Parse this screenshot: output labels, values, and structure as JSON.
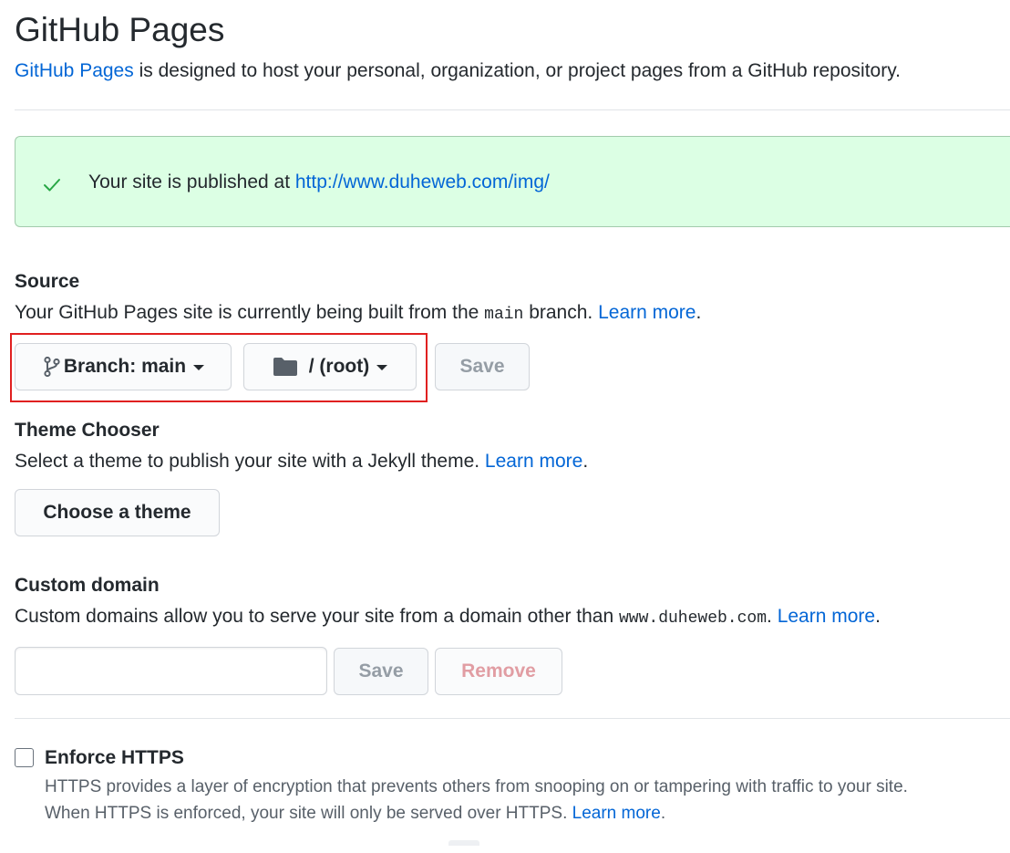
{
  "header": {
    "title": "GitHub Pages",
    "intro_link": "GitHub Pages",
    "intro_rest": " is designed to host your personal, organization, or project pages from a GitHub repository."
  },
  "flash": {
    "message": "Your site is published at ",
    "url": "http://www.duheweb.com/img/",
    "icon": "check-icon",
    "color": "#28a745"
  },
  "source": {
    "title": "Source",
    "desc_before": "Your GitHub Pages site is currently being built from the ",
    "branch_code": "main",
    "desc_after": " branch. ",
    "learn_more": "Learn more",
    "period": ".",
    "branch_button": "Branch: main",
    "folder_button": "/ (root)",
    "save_button": "Save",
    "highlight_color": "#e02020"
  },
  "theme": {
    "title": "Theme Chooser",
    "desc": "Select a theme to publish your site with a Jekyll theme. ",
    "learn_more": "Learn more",
    "period": ".",
    "button": "Choose a theme"
  },
  "custom_domain": {
    "title": "Custom domain",
    "desc_before": "Custom domains allow you to serve your site from a domain other than ",
    "domain_code": "www.duheweb.com",
    "desc_after": ". ",
    "learn_more": "Learn more",
    "period": ".",
    "input_value": "",
    "save_button": "Save",
    "remove_button": "Remove"
  },
  "https": {
    "label": "Enforce HTTPS",
    "checked": false,
    "note_line1": "HTTPS provides a layer of encryption that prevents others from snooping on or tampering with traffic to your site.",
    "note_line2": "When HTTPS is enforced, your site will only be served over HTTPS. ",
    "learn_more": "Learn more",
    "period": "."
  },
  "colors": {
    "link": "#0366d6",
    "flash_bg": "#dcffe4",
    "text": "#24292e"
  }
}
